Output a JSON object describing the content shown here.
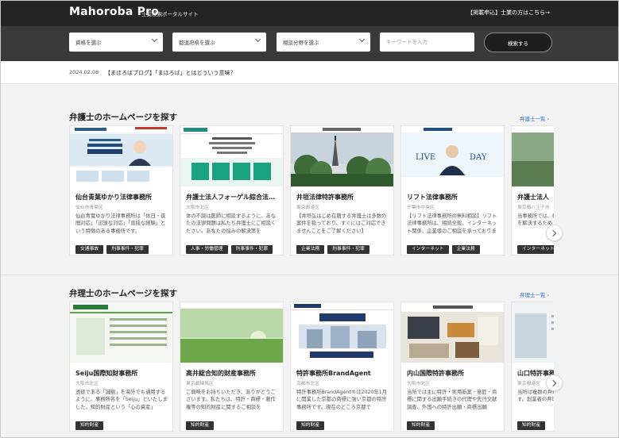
{
  "header": {
    "logo": "Mahoroba Pro",
    "tagline": "士業検索ポータルサイト",
    "recruit_link": "【掲載申込】士業の方はこちら→"
  },
  "search": {
    "qualification": "資格を選ぶ",
    "prefecture": "都道府県を選ぶ",
    "field": "相談分野を選ぶ",
    "keyword_placeholder": "キーワードを入力",
    "button": "検索する"
  },
  "news": {
    "date": "2024.02.08",
    "text": "【まほろばブログ】「まほろば」とはどういう意味？"
  },
  "sections": [
    {
      "title": "弁護士のホームページを探す",
      "more": "弁護士一覧",
      "cards": [
        {
          "name": "仙台青葉ゆかり法律事務所",
          "area": "仙台市青葉区",
          "desc": "仙台青葉ゆかり法律事務所は「休日・夜間対応」「迅速な対応」「直接な経験」という特徴のある事務所です。",
          "tags": [
            "交通事故",
            "刑事事件・犯罪"
          ]
        },
        {
          "name": "弁護士法人フォーゲル綜合法律事務所",
          "area": "大阪市北区",
          "desc": "体の不調は医師に相談するように、あなたの法律問題は私たち弁護士にご相談ください。あなたの悩みの解決策を",
          "tags": [
            "人事・労働管理",
            "刑事事件・犯罪"
          ]
        },
        {
          "name": "井垣法律特許事務所",
          "area": "東京都港区",
          "desc": "【井垣弘はじめ在籍する弁護士は多数の案件を扱っており、すぐにはご対応できませんことをご了解ください】",
          "tags": [
            "企業法務",
            "刑事事件・犯罪"
          ]
        },
        {
          "name": "リフト法律事務所",
          "area": "千葉市中央区",
          "desc": "【リフト法律事務所の無料相談】リフト法律事務所は、相続全般、インターネット関係、企業様のご相談を承っております。",
          "tags": [
            "インターネット",
            "企業法務"
          ]
        },
        {
          "name": "弁護士法人",
          "area": "東京都八王子市",
          "desc": "当事務所では、幅広い顧客様の法律問題を解決するため",
          "tags": [
            "インターネット"
          ]
        }
      ]
    },
    {
      "title": "弁理士のホームページを探す",
      "more": "弁理士一覧",
      "cards": [
        {
          "name": "Seiju国際知財事務所",
          "area": "大阪市北区",
          "desc": "透徳である「誠樹」を海外でも通用するように、事務所名を「Seiju」といたしました。知的財産という「心の資産」",
          "tags": [
            "知的財産"
          ]
        },
        {
          "name": "高井総合知的財産事務所",
          "area": "東京都練馬区",
          "desc": "ご興味をお持ちいただき、ありがとうございます。私たちは、特許・商標・著作権等の知的財産に関するご相談を",
          "tags": [
            "知的財産"
          ]
        },
        {
          "name": "特許事務所BrandAgent",
          "area": "京都市北区",
          "desc": "特許事務所BrandAgent®は2020年1月に開業した京都の商標に強い京都の特許事務所です。現在のところ京都で",
          "tags": [
            "知的財産"
          ]
        },
        {
          "name": "内山国際特許事務所",
          "area": "大阪市北区",
          "desc": "当所では主に特許・実用新案・意匠・商標に関する出願手続きの代理や先行文献調査、外国への特許出願・商標出願",
          "tags": [
            "知的財産"
          ]
        },
        {
          "name": "山口特許事務所",
          "area": "東京都港区",
          "desc": "当所は複数の弁理士で所営しております。創業者の弁理士が迅速かつ丁寧に",
          "tags": [
            "知的財産"
          ]
        }
      ]
    }
  ]
}
